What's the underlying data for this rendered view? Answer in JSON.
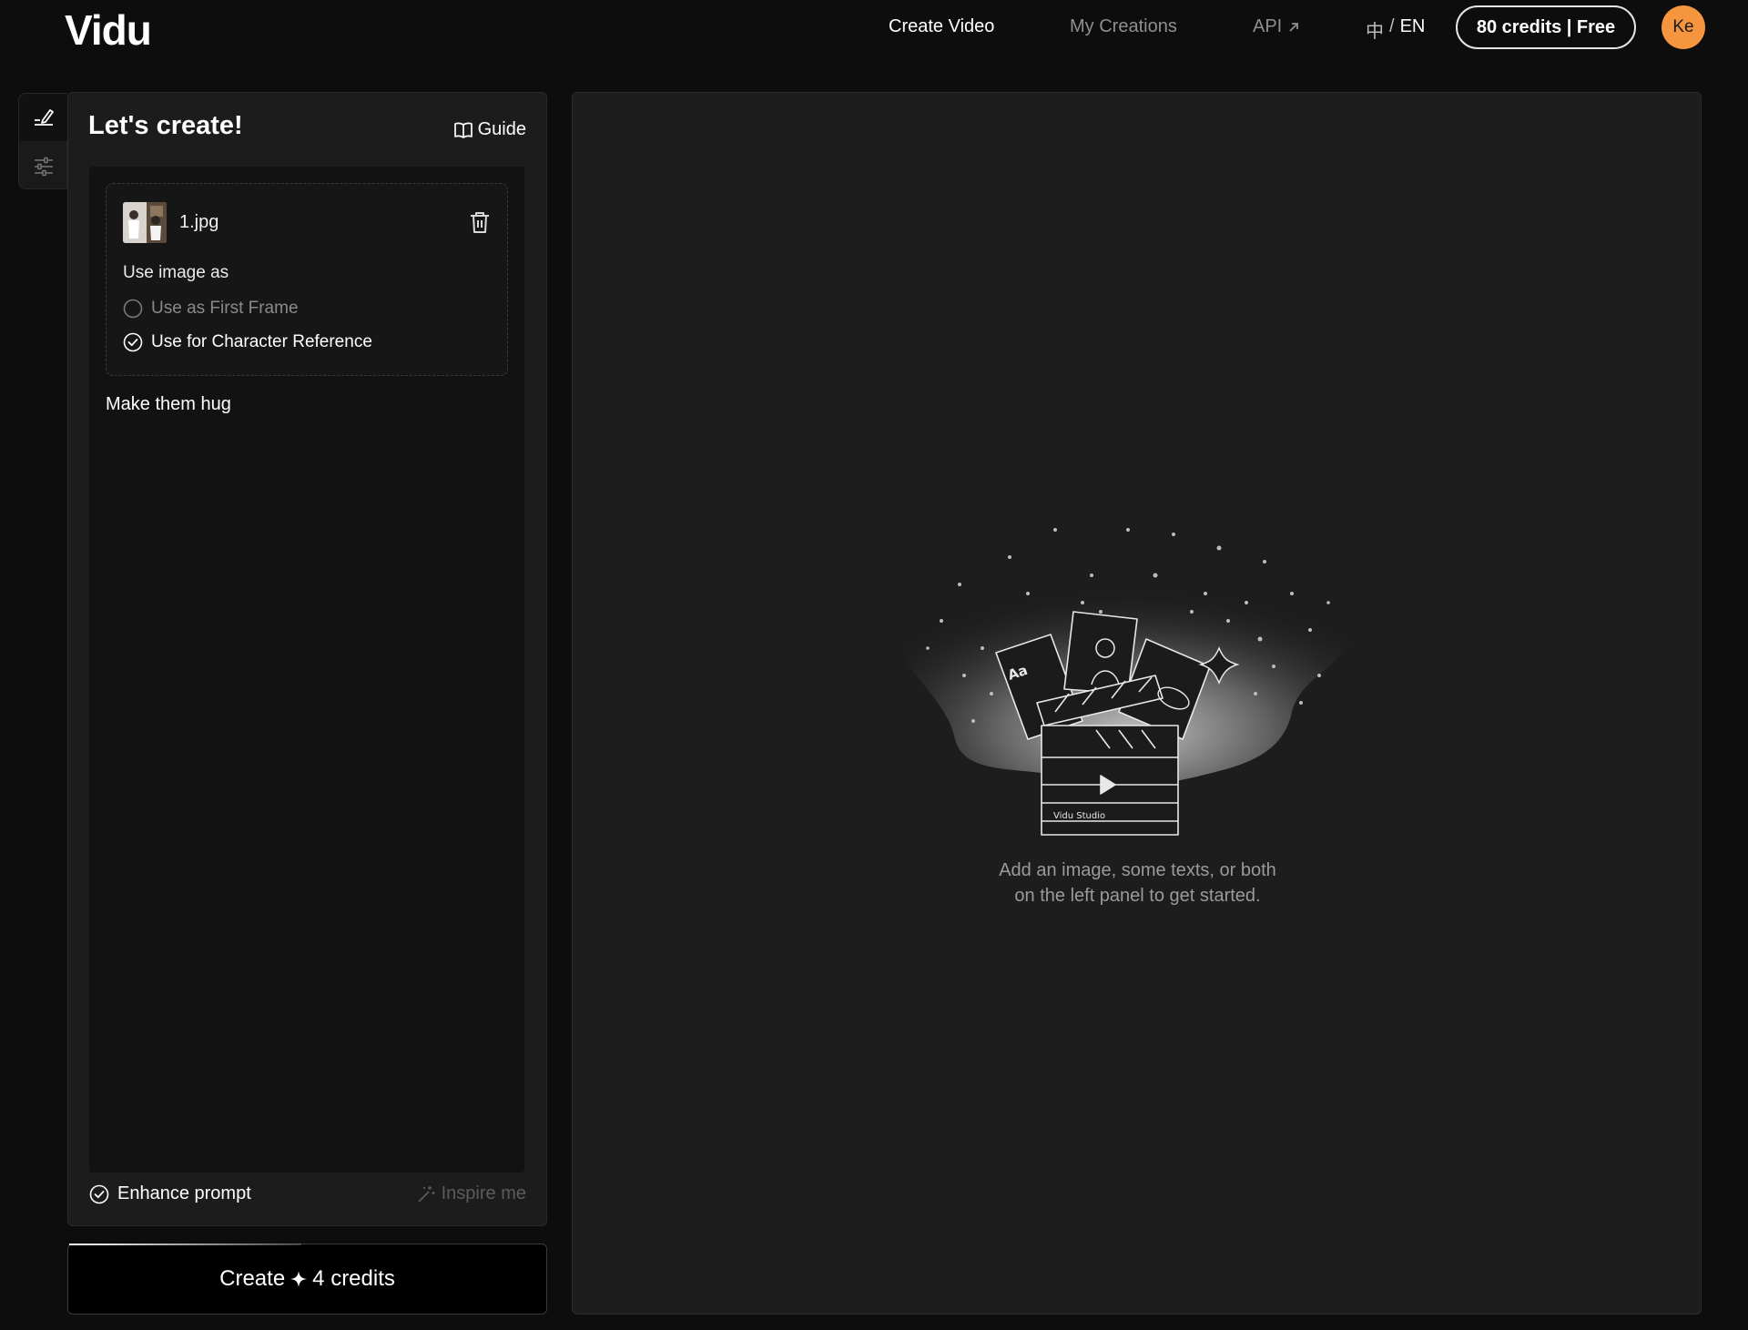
{
  "app": {
    "logo": "Vidu"
  },
  "nav": {
    "create_video": "Create Video",
    "my_creations": "My Creations",
    "api": "API",
    "lang_zh": "中",
    "lang_sep": "/",
    "lang_en": "EN",
    "credits": "80 credits | Free",
    "avatar_initials": "Ke"
  },
  "panel": {
    "title": "Let's create!",
    "guide": "Guide",
    "image": {
      "file_name": "1.jpg",
      "use_as_label": "Use image as",
      "options": [
        {
          "label": "Use as First Frame",
          "selected": false
        },
        {
          "label": "Use for Character Reference",
          "selected": true
        }
      ]
    },
    "prompt": "Make them hug",
    "enhance_prompt": "Enhance prompt",
    "inspire_me": "Inspire me"
  },
  "create_button": {
    "label": "Create",
    "credits": "4 credits"
  },
  "preview": {
    "illustration_label": "Vidu Studio",
    "illustration_text": "Aa",
    "empty_line1": "Add an image, some texts, or both",
    "empty_line2": "on the left panel to get started."
  },
  "colors": {
    "background": "#0d0d0d",
    "panel": "#1c1c1c",
    "avatar": "#f5953e"
  }
}
